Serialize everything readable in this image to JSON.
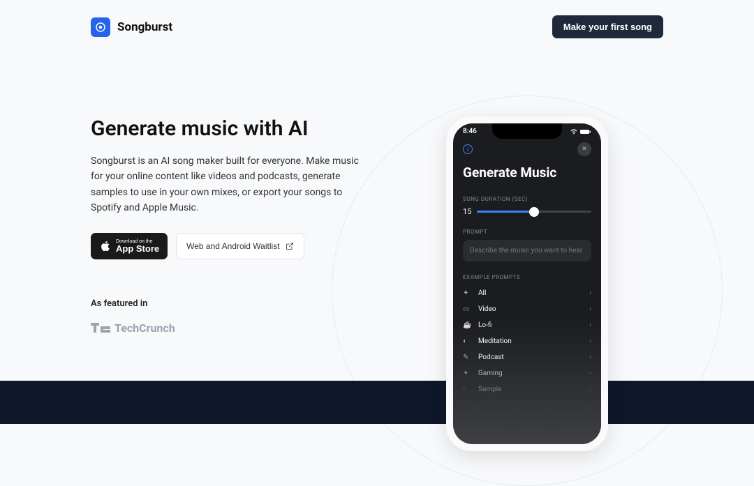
{
  "header": {
    "brand": "Songburst",
    "cta": "Make your first song"
  },
  "hero": {
    "title": "Generate music with AI",
    "description": "Songburst is an AI song maker built for everyone. Make music for your online content like videos and podcasts, generate samples to use in your own mixes, or export your songs to Spotify and Apple Music.",
    "appstore_small": "Download on the",
    "appstore_big": "App Store",
    "waitlist": "Web and Android Waitlist"
  },
  "featured": {
    "label": "As featured in",
    "outlet": "TechCrunch"
  },
  "phone": {
    "time": "8:46",
    "title": "Generate Music",
    "duration_label": "SONG DURATION (SEC)",
    "duration_value": "15",
    "prompt_label": "PROMPT",
    "prompt_placeholder": "Describe the music you want to hear",
    "examples_label": "EXAMPLE PROMPTS",
    "examples": [
      {
        "icon": "✦",
        "label": "All"
      },
      {
        "icon": "▭",
        "label": "Video"
      },
      {
        "icon": "☕",
        "label": "Lo-fi"
      },
      {
        "icon": "◐",
        "label": "Meditation"
      },
      {
        "icon": "✎",
        "label": "Podcast"
      },
      {
        "icon": "✦",
        "label": "Gaming"
      },
      {
        "icon": "•",
        "label": "Sample"
      }
    ]
  }
}
